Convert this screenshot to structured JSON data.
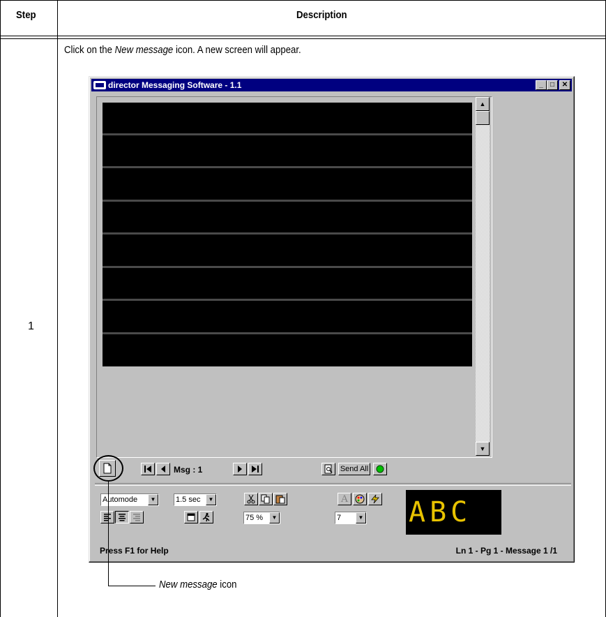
{
  "table": {
    "header_step": "Step",
    "header_description": "Description",
    "step_number": "1",
    "instruction_prefix": "Click on the ",
    "instruction_italic": "New message",
    "instruction_suffix": " icon. A new screen will appear."
  },
  "window": {
    "title": "director  Messaging Software - 1.1",
    "minimize_glyph": "_",
    "maximize_glyph": "□",
    "close_glyph": "✕"
  },
  "toolbar": {
    "msg_label": "Msg : 1",
    "send_all_label": "Send All",
    "mode_value": "Automode",
    "time_value": "1.5 sec",
    "zoom_value": "75 %",
    "size_value": "7",
    "preview_text": "ABC",
    "preview_color": "#e8c200",
    "status_indicator_color": "#00c000"
  },
  "status": {
    "left": "Press F1 for Help",
    "right": "Ln 1 - Pg 1  - Message 1  /1"
  },
  "callout": {
    "label_italic": "New message",
    "label_suffix": " icon"
  }
}
